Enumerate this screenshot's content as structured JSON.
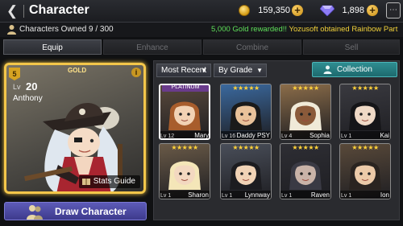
{
  "header": {
    "title": "Character",
    "gold": "159,350",
    "gems": "1,898",
    "back_icon": "back-arrow-icon",
    "colors": {
      "gold": "#f2c23a",
      "gem": "#7b6cf0"
    }
  },
  "info": {
    "owned_label": "Characters Owned",
    "owned_count": "9 / 300",
    "ticker_gold": "5,000 Gold rewarded!!",
    "ticker_user": "Yozusoft obtained",
    "ticker_item": "Rainbow Part"
  },
  "tabs": [
    {
      "label": "Equip",
      "active": true
    },
    {
      "label": "Enhance",
      "active": false
    },
    {
      "label": "Combine",
      "active": false
    },
    {
      "label": "Sell",
      "active": false
    }
  ],
  "featured": {
    "grade": "GOLD",
    "grade_rank": "5",
    "level_label": "Lv",
    "level": "20",
    "name": "Anthony",
    "stats_guide": "Stats Guide"
  },
  "draw_button": "Draw Character",
  "filters": {
    "sort": "Most Recent",
    "grade": "By Grade",
    "collection": "Collection"
  },
  "characters": [
    {
      "name": "Mary",
      "level": "12",
      "stars": "★★★★★",
      "badge": "PLATINUM",
      "selected": true,
      "bg": "#5b4a3c",
      "hair": "#a85d2c",
      "skin": "#f2d2b4"
    },
    {
      "name": "Daddy PSY",
      "level": "16",
      "stars": "★★★★★",
      "badge": "",
      "selected": false,
      "bg": "#3b6aa0",
      "hair": "#1a1a1a",
      "skin": "#e9c29a"
    },
    {
      "name": "Sophia",
      "level": "4",
      "stars": "★★★★★",
      "badge": "",
      "selected": false,
      "bg": "#8d6e4a",
      "hair": "#f0ead8",
      "skin": "#8a5a3a"
    },
    {
      "name": "Kai",
      "level": "1",
      "stars": "★★★★★",
      "badge": "",
      "selected": false,
      "bg": "#3a3a40",
      "hair": "#151518",
      "skin": "#efd9c6"
    },
    {
      "name": "Sharon",
      "level": "1",
      "stars": "★★★★★",
      "badge": "",
      "selected": false,
      "bg": "#6b5b48",
      "hair": "#f4e6b8",
      "skin": "#f3d8c0"
    },
    {
      "name": "Lynnway",
      "level": "1",
      "stars": "★★★★★",
      "badge": "",
      "selected": false,
      "bg": "#4a4f5a",
      "hair": "#1c1c20",
      "skin": "#f1d3b6"
    },
    {
      "name": "Raven",
      "level": "1",
      "stars": "★★★★★",
      "badge": "",
      "selected": false,
      "bg": "#2e2e34",
      "hair": "#3a3a44",
      "skin": "#c9b3a8"
    },
    {
      "name": "Ion",
      "level": "1",
      "stars": "★★★★★",
      "badge": "",
      "selected": false,
      "bg": "#5a4a3a",
      "hair": "#2a2420",
      "skin": "#eccaa8"
    }
  ]
}
